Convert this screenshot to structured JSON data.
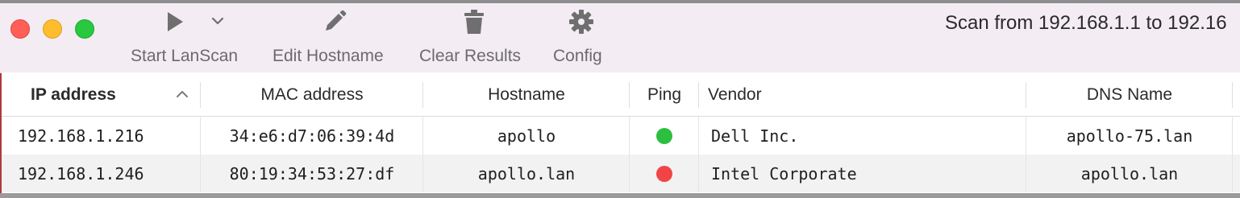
{
  "window": {
    "scan_title": "Scan from 192.168.1.1 to 192.16"
  },
  "toolbar": {
    "start_label": "Start LanScan",
    "edit_label": "Edit Hostname",
    "clear_label": "Clear Results",
    "config_label": "Config",
    "icons": {
      "start": "play-icon",
      "start_menu": "chevron-down-icon",
      "edit": "pencil-icon",
      "clear": "trash-icon",
      "config": "gear-icon"
    }
  },
  "table": {
    "columns": [
      "IP address",
      "MAC address",
      "Hostname",
      "Ping",
      "Vendor",
      "DNS Name"
    ],
    "sort_icon": "chevron-up-icon",
    "rows": [
      {
        "ip": "192.168.1.216",
        "mac": "34:e6:d7:06:39:4d",
        "hostname": "apollo",
        "ping_status": "up",
        "ping_color": "#2dbf3f",
        "vendor": "Dell Inc.",
        "dns": "apollo-75.lan"
      },
      {
        "ip": "192.168.1.246",
        "mac": "80:19:34:53:27:df",
        "hostname": "apollo.lan",
        "ping_status": "down",
        "ping_color": "#f14545",
        "vendor": "Intel Corporate",
        "dns": "apollo.lan"
      }
    ]
  },
  "colors": {
    "toolbar_bg": "#f3ecf3",
    "close": "#ff5f57",
    "minimize": "#febc2e",
    "maximize": "#28c840"
  }
}
